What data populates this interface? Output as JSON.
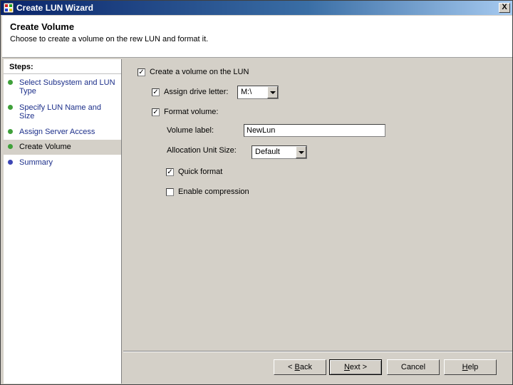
{
  "window": {
    "title": "Create LUN Wizard",
    "close_glyph": "X"
  },
  "header": {
    "title": "Create Volume",
    "subtitle": "Choose to create a volume on the rew LUN and format it."
  },
  "steps": {
    "heading": "Steps:",
    "items": [
      {
        "label": "Select Subsystem and LUN Type",
        "state": "done"
      },
      {
        "label": "Specify LUN Name and Size",
        "state": "done"
      },
      {
        "label": "Assign Server Access",
        "state": "done"
      },
      {
        "label": "Create Volume",
        "state": "current"
      },
      {
        "label": "Summary",
        "state": "pending"
      }
    ]
  },
  "form": {
    "create_volume": {
      "label": "Create a volume on the LUN",
      "checked": true,
      "glyph": "✓"
    },
    "assign_drive": {
      "label": "Assign drive letter:",
      "checked": true,
      "glyph": "✓",
      "value": "M:\\"
    },
    "format_volume": {
      "label": "Format volume:",
      "checked": true,
      "glyph": "✓"
    },
    "volume_label": {
      "label": "Volume label:",
      "value": "NewLun"
    },
    "allocation": {
      "label": "Allocation Unit Size:",
      "value": "Default"
    },
    "quick_format": {
      "label": "Quick format",
      "checked": true,
      "glyph": "✓"
    },
    "compression": {
      "label": "Enable compression",
      "checked": false,
      "glyph": ""
    }
  },
  "buttons": {
    "back": {
      "mnemonic": "B",
      "prefix": "< ",
      "rest": "ack"
    },
    "next": {
      "mnemonic": "N",
      "rest": "ext >"
    },
    "cancel": "Cancel",
    "help": {
      "mnemonic": "H",
      "rest": "elp"
    }
  },
  "colors": {
    "titlebar_start": "#0a246a",
    "step_done": "#3fa03a",
    "step_pending": "#3d46b5",
    "dialog_bg": "#d4d0c8"
  }
}
